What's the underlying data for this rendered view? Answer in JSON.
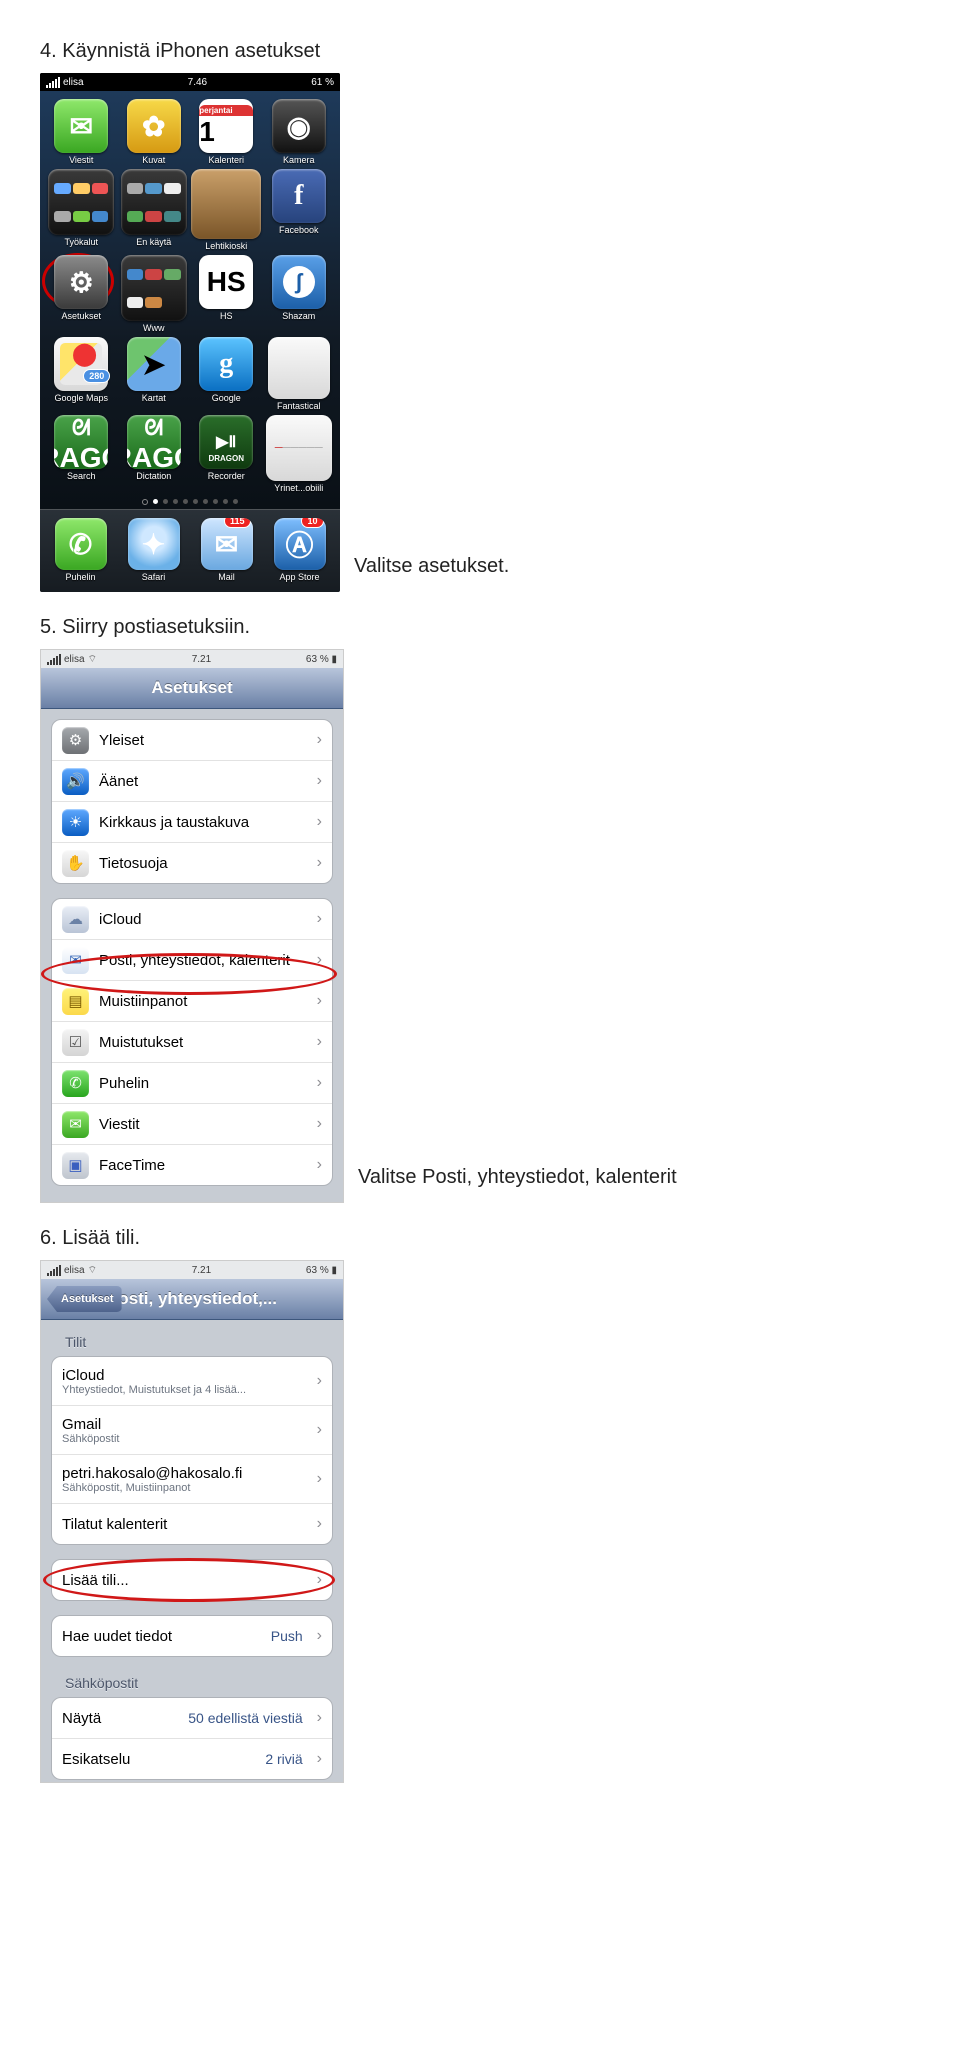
{
  "steps": {
    "s4": "4.  Käynnistä iPhonen asetukset",
    "s5": "5.  Siirry postiasetuksiin.",
    "s6": "6.  Lisää tili.",
    "cap1": "Valitse asetukset.",
    "cap2": "Valitse Posti, yhteystiedot, kalenterit"
  },
  "phone1": {
    "status": {
      "carrier": "elisa",
      "time": "7.46",
      "battery": "61 %"
    },
    "cal_top": "perjantai",
    "cal_num": "1",
    "maps_badge": "280",
    "mail_badge": "115",
    "store_badge": "10",
    "apps": {
      "r1": [
        "Viestit",
        "Kuvat",
        "Kalenteri",
        "Kamera"
      ],
      "r2": [
        "Työkalut",
        "En käytä",
        "Lehtikioski",
        "Facebook"
      ],
      "r3": [
        "Asetukset",
        "Www",
        "HS",
        "Shazam"
      ],
      "r4": [
        "Google Maps",
        "Kartat",
        "Google",
        "Fantastical"
      ],
      "r5": [
        "Search",
        "Dictation",
        "Recorder",
        "Yrinet...obiili"
      ]
    },
    "dragon": "DRAGON",
    "dock": [
      "Puhelin",
      "Safari",
      "Mail",
      "App Store"
    ]
  },
  "phone2": {
    "status": {
      "carrier": "elisa",
      "time": "7.21",
      "battery": "63 %"
    },
    "title": "Asetukset",
    "rows": {
      "yleiset": "Yleiset",
      "aanet": "Äänet",
      "kirkkaus": "Kirkkaus ja taustakuva",
      "tieto": "Tietosuoja",
      "icloud": "iCloud",
      "posti": "Posti, yhteystiedot, kalenterit",
      "muistiin": "Muistiinpanot",
      "muistutukset": "Muistutukset",
      "puhelin": "Puhelin",
      "viestit": "Viestit",
      "facetime": "FaceTime"
    }
  },
  "phone3": {
    "status": {
      "carrier": "elisa",
      "time": "7.21",
      "battery": "63 %"
    },
    "back": "Asetukset",
    "title": "Posti, yhteystiedot,...",
    "sect_tilit": "Tilit",
    "rows": {
      "icloud": "iCloud",
      "icloud_sub": "Yhteystiedot, Muistutukset ja 4 lisää...",
      "gmail": "Gmail",
      "gmail_sub": "Sähköpostit",
      "hako": "petri.hakosalo@hakosalo.fi",
      "hako_sub": "Sähköpostit, Muistiinpanot",
      "tilatut": "Tilatut kalenterit",
      "lisaa": "Lisää tili...",
      "hae": "Hae uudet tiedot",
      "hae_val": "Push",
      "sect_sp": "Sähköpostit",
      "nayta": "Näytä",
      "nayta_val": "50 edellistä viestiä",
      "esik": "Esikatselu",
      "esik_val": "2 riviä"
    }
  }
}
